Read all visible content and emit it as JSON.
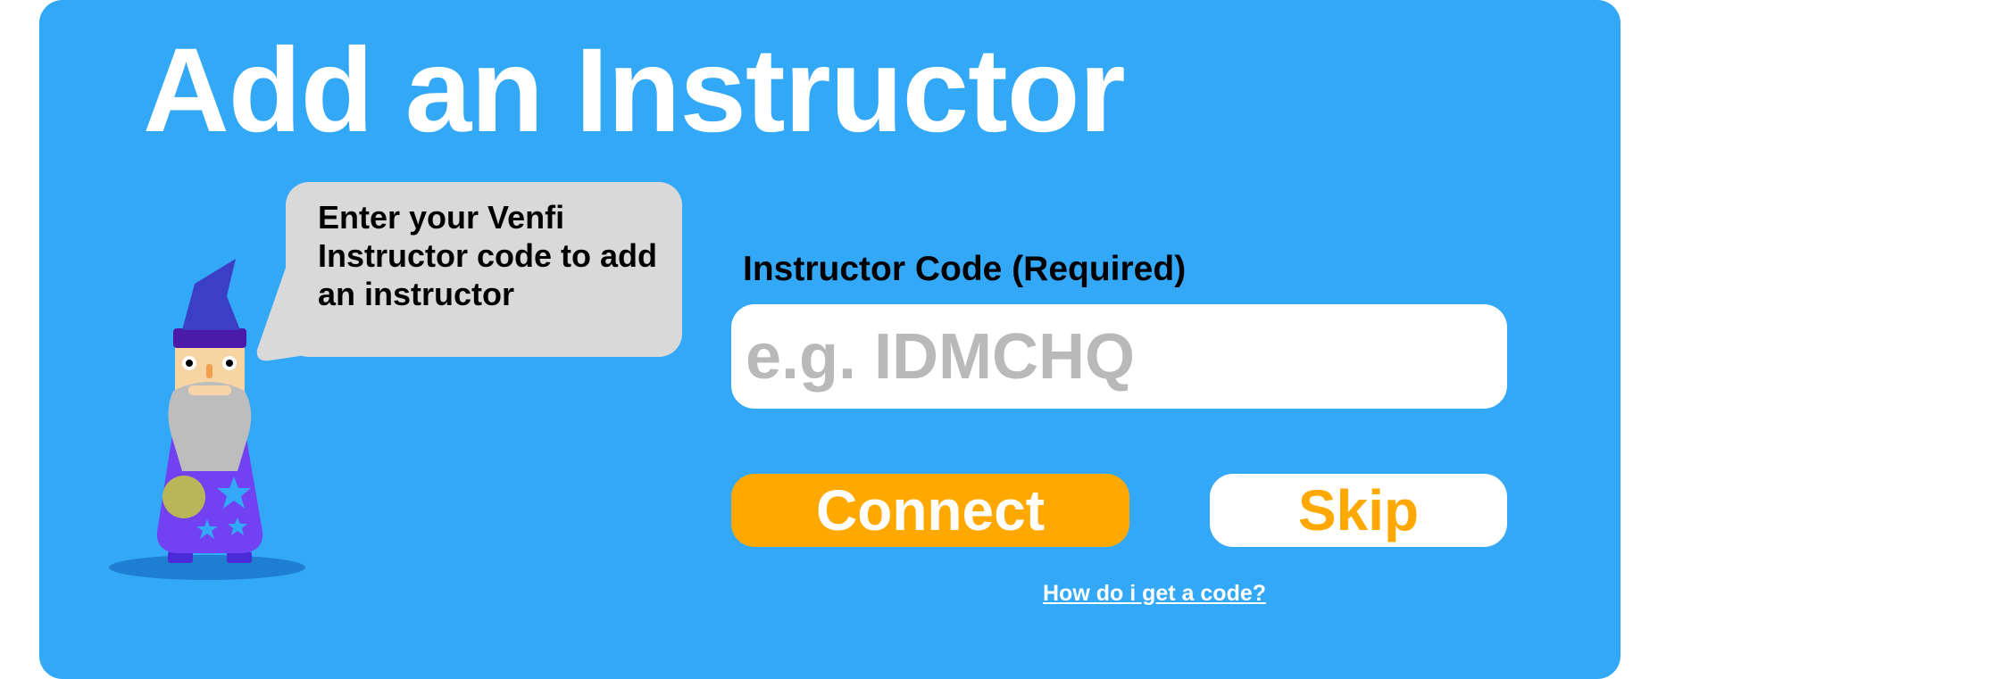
{
  "page": {
    "title": "Add an Instructor"
  },
  "mascot": {
    "speech": "Enter your Venfi Instructor code to add an instructor"
  },
  "form": {
    "code_label": "Instructor Code (Required)",
    "code_placeholder": "e.g. IDMCHQ",
    "code_value": ""
  },
  "actions": {
    "connect_label": "Connect",
    "skip_label": "Skip",
    "help_link": "How do i get a code?"
  },
  "colors": {
    "panel_background": "#33a8f7",
    "primary_button": "#ffa800",
    "primary_button_text": "#ffffff",
    "secondary_button": "#ffffff",
    "secondary_button_text": "#ffa800",
    "speech_bubble": "#d9d9d9",
    "placeholder_text": "#b9b9b9"
  },
  "icons": {
    "mascot": "wizard-mascot-icon"
  }
}
